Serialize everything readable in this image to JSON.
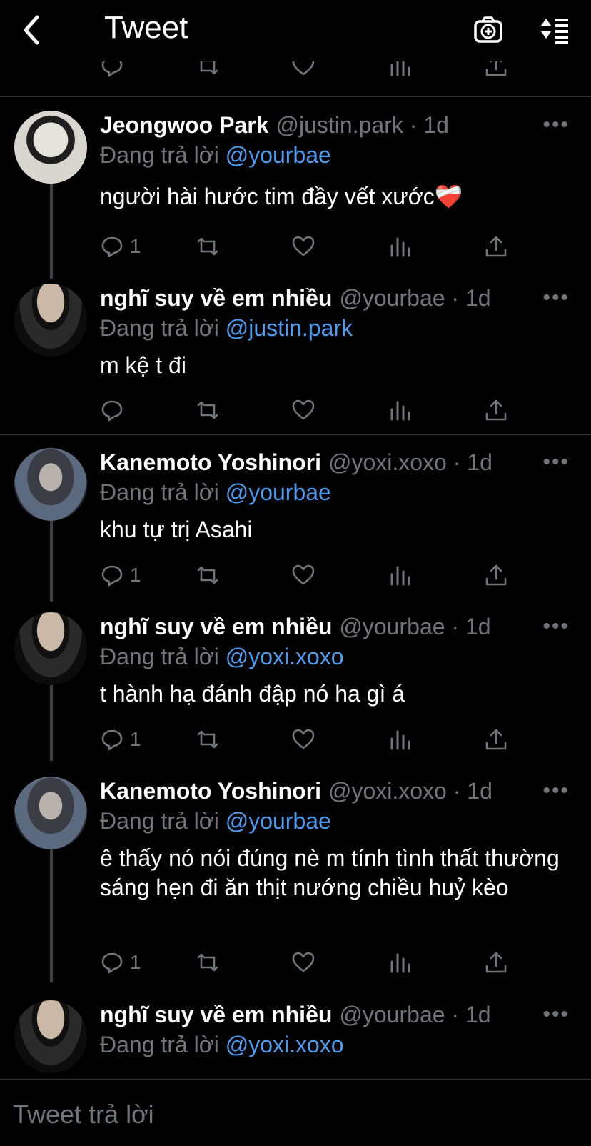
{
  "header": {
    "title": "Tweet",
    "icons": [
      "back-arrow-icon",
      "camera-add-icon",
      "sort-icon"
    ]
  },
  "colors": {
    "background": "#000000",
    "mention": "#4c9df0",
    "muted": "#71767b",
    "divider": "#2f3336"
  },
  "tweets": [
    {
      "name": "Jeongwoo Park",
      "handle": "@justin.park · 1d",
      "reply_label": "Đang trả lời",
      "reply_to": "@yourbae",
      "text": "người hài hước tim đầy vết xước❤️‍🩹",
      "reply_count": "1"
    },
    {
      "name": "nghĩ suy về em nhiều",
      "handle": "@yourbae · 1d",
      "reply_label": "Đang trả lời",
      "reply_to": "@justin.park",
      "text": "m kệ t đi",
      "reply_count": ""
    },
    {
      "name": "Kanemoto Yoshinori",
      "handle": "@yoxi.xoxo · 1d",
      "reply_label": "Đang trả lời",
      "reply_to": "@yourbae",
      "text": "khu tự trị Asahi",
      "reply_count": "1"
    },
    {
      "name": "nghĩ suy về em nhiều",
      "handle": "@yourbae · 1d",
      "reply_label": "Đang trả lời",
      "reply_to": "@yoxi.xoxo",
      "text": "t hành hạ đánh đập nó ha gì á",
      "reply_count": "1"
    },
    {
      "name": "Kanemoto Yoshinori",
      "handle": "@yoxi.xoxo · 1d",
      "reply_label": "Đang trả lời",
      "reply_to": "@yourbae",
      "text": "ê thấy nó nói đúng nè m tính tình thất thường sáng hẹn đi ăn thịt nướng chiều huỷ kèo",
      "reply_count": "1"
    },
    {
      "name": "nghĩ suy về em nhiều",
      "handle": "@yourbae · 1d",
      "reply_label": "Đang trả lời",
      "reply_to": "@yoxi.xoxo",
      "text": "",
      "reply_count": ""
    }
  ],
  "composer": {
    "placeholder": "Tweet trả lời"
  }
}
